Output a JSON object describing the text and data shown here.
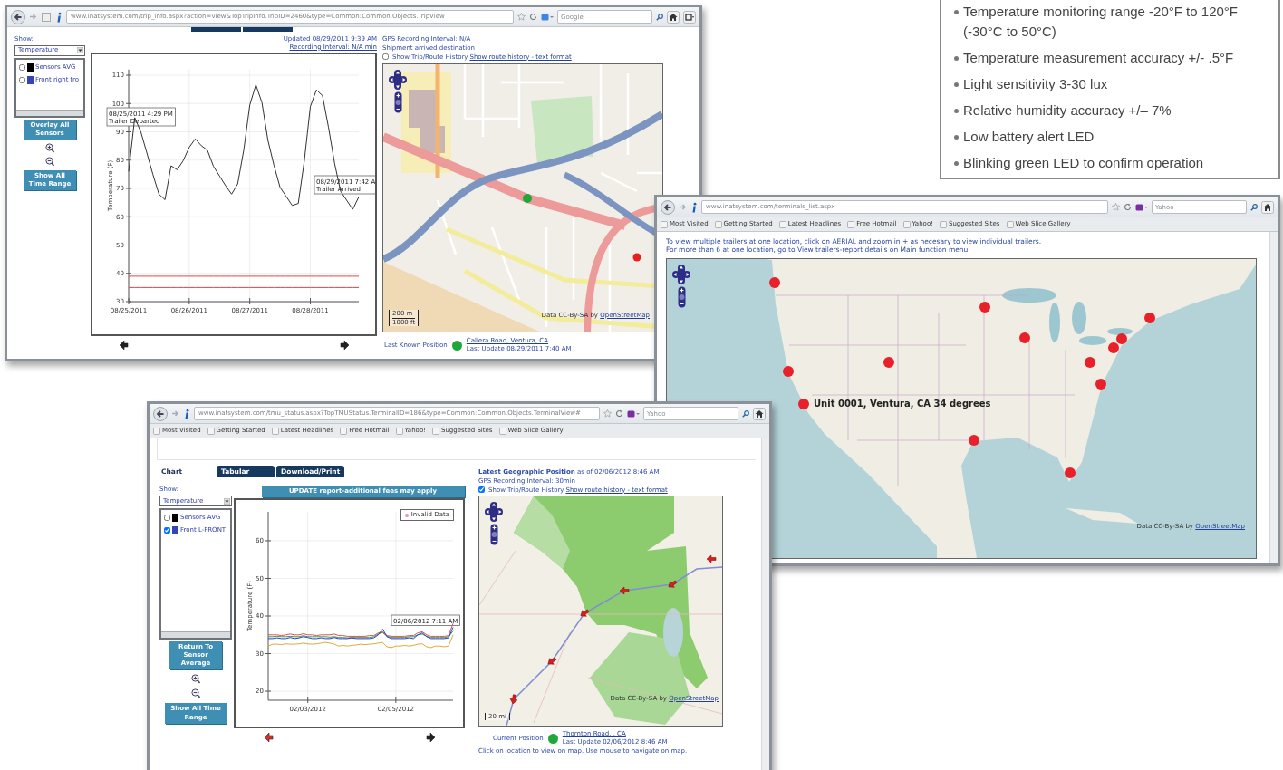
{
  "spec_box": {
    "items": [
      "Temperature monitoring range -20°F to 120°F (-30°C to 50°C)",
      "Temperature measurement accuracy +/- .5°F",
      "Light sensitivity 3-30 lux",
      "Relative humidity accuracy +/– 7%",
      "Low battery alert LED",
      "Blinking green LED to confirm operation"
    ]
  },
  "trip_window": {
    "url": "www.inatsystem.com/trip_info.aspx?action=view&TopTripInfo.TripID=2460&type=Common:Common.Objects.TripView",
    "search_placeholder": "Google",
    "show_label": "Show:",
    "sensor_select": "Temperature",
    "sensors": [
      {
        "name": "Sensors AVG",
        "color": "#000000",
        "checked": false
      },
      {
        "name": "Front right fro",
        "color": "#3344bb",
        "checked": false
      }
    ],
    "buttons": [
      "Overlay All Sensors",
      "Show All Time Range"
    ],
    "updated": "Updated 08/29/2011 9:39 AM",
    "recording_interval": "Recording Interval: N/A min",
    "chart_data": {
      "type": "line",
      "ylabel": "Temperature (F)",
      "ylim": [
        30,
        112
      ],
      "grid": true,
      "categories": [
        "08/25/2011",
        null,
        null,
        null,
        null,
        null,
        null,
        null,
        null,
        null,
        "08/26/2011",
        null,
        null,
        null,
        null,
        null,
        null,
        null,
        null,
        null,
        "08/27/2011",
        null,
        null,
        null,
        null,
        null,
        null,
        null,
        null,
        null,
        "08/28/2011",
        null,
        null,
        null,
        null,
        null,
        null,
        null,
        null
      ],
      "yticks": [
        30,
        40,
        50,
        60,
        70,
        80,
        90,
        100,
        110
      ],
      "series": [
        {
          "color": "#333333",
          "values": [
            76,
            95,
            90,
            82.5,
            75,
            68,
            66,
            78,
            76.6,
            79.8,
            84.5,
            87.5,
            85.1,
            83.5,
            77.8,
            74.4,
            71,
            68,
            71.6,
            83.5,
            99.5,
            106.6,
            100.3,
            87,
            78.1,
            70.4,
            67.2,
            64,
            64.7,
            79.6,
            98.9,
            104.8,
            102.8,
            91.5,
            78.8,
            69,
            65.8,
            62.6,
            67
          ]
        },
        {
          "color": "#e84040",
          "values": [
            39,
            39,
            39,
            39,
            39,
            39,
            39,
            39,
            39,
            39,
            39,
            39,
            39,
            39,
            39,
            39,
            39,
            39,
            39,
            39,
            39,
            39,
            39,
            39,
            39,
            39,
            39,
            39,
            39,
            39,
            39,
            39,
            39,
            39,
            39,
            39,
            39,
            39,
            39
          ]
        },
        {
          "color": "#e84040",
          "values": [
            35,
            35,
            35,
            35,
            35,
            35,
            35,
            35,
            35,
            35,
            35,
            35,
            35,
            35,
            35,
            35,
            35,
            35,
            35,
            35,
            35,
            35,
            35,
            35,
            35,
            35,
            35,
            35,
            35,
            35,
            35,
            35,
            35,
            35,
            35,
            35,
            35,
            35,
            35
          ]
        }
      ],
      "annotations": [
        "08/25/2011 4:29 PM\nTrailer Departed",
        "08/29/2011 7:42 A\nTrailer Arrived"
      ]
    },
    "gps_interval": "GPS Recording Interval: N/A",
    "shipment_status": "Shipment arrived destination",
    "route_history": {
      "checked": false,
      "label": "Show Trip/Route History",
      "link": "Show route history - text format"
    },
    "map": {
      "scale": [
        "200 m",
        "1000 ft"
      ],
      "attribution": "Data CC-By-SA by",
      "attribution_link": "OpenStreetMap"
    },
    "position_label": "Last Known Position",
    "location_link": "Callera Road, Ventura, CA",
    "last_update": "Last Update 08/29/2011 7:40 AM"
  },
  "terminals_window": {
    "url": "www.inatsystem.com/terminals_list.aspx",
    "search_placeholder": "Yahoo",
    "bookmarks": [
      "Most Visited",
      "Getting Started",
      "Latest Headlines",
      "Free Hotmail",
      "Yahoo!",
      "Suggested Sites",
      "Web Slice Gallery"
    ],
    "instructions": [
      "To view multiple trailers at one location, click on AERIAL and zoom in + as necesary to view individual trailers.",
      "For more than 6 at one location, go to View trailers-report details on Main function menu."
    ],
    "map_label": "Unit 0001, Ventura, CA 34 degrees",
    "map": {
      "attribution": "Data CC-By-SA by",
      "attribution_link": "OpenStreetMap"
    }
  },
  "status_window": {
    "url": "www.inatsystem.com/tmu_status.aspx?TopTMUStatus.TerminalID=186&type=Common:Common.Objects.TerminalView#",
    "search_placeholder": "Yahoo",
    "bookmarks": [
      "Most Visited",
      "Getting Started",
      "Latest Headlines",
      "Free Hotmail",
      "Yahoo!",
      "Suggested Sites",
      "Web Slice Gallery"
    ],
    "tabs": [
      {
        "label": "Chart",
        "selected": true
      },
      {
        "label": "Tabular",
        "selected": false
      },
      {
        "label": "Download/Print",
        "selected": false
      }
    ],
    "show_label": "Show:",
    "sensor_select": "Temperature",
    "sensors": [
      {
        "name": "Sensors AVG",
        "color": "#000000",
        "checked": false
      },
      {
        "name": "Front L-FRONT",
        "color": "#3344bb",
        "checked": true
      }
    ],
    "update_button": "UPDATE report-additional fees may apply",
    "data_key": {
      "label": "Invalid Data",
      "color": "#f48fb1"
    },
    "buttons": [
      "Return To Sensor Average",
      "Show All Time Range"
    ],
    "chart_data": {
      "type": "line",
      "ylabel": "Temperature (F)",
      "ylim": [
        17.6,
        67.7
      ],
      "grid": true,
      "categories": [
        null,
        null,
        null,
        null,
        null,
        null,
        null,
        null,
        null,
        "02/03/2012",
        null,
        null,
        null,
        null,
        null,
        null,
        null,
        null,
        null,
        null,
        null,
        null,
        null,
        null,
        null,
        null,
        null,
        null,
        null,
        "02/05/2012",
        null,
        null,
        null,
        null,
        null,
        null,
        null,
        null,
        null,
        null,
        null,
        null,
        null
      ],
      "yticks": [
        20,
        30,
        40,
        50,
        60
      ],
      "series": [
        {
          "color": "#e05050",
          "values": [
            35,
            35,
            35,
            34.8,
            35,
            35.2,
            35,
            35,
            35.3,
            35,
            35,
            34.8,
            35,
            35,
            35,
            35.2,
            34.8,
            34.8,
            34.6,
            34.6,
            34.6,
            34.6,
            34.6,
            34.8,
            34.8,
            35.5,
            35.8,
            34.8,
            34.6,
            34.6,
            34.6,
            34.6,
            34.8,
            34.8,
            35.5,
            35.8,
            35,
            34.6,
            34.6,
            34.6,
            34.6,
            34.8,
            38
          ]
        },
        {
          "color": "#3a9a4a",
          "values": [
            34.5,
            34.5,
            34.6,
            34.5,
            34.5,
            34.6,
            34.5,
            34.5,
            34.8,
            34.5,
            34.5,
            34.5,
            34.5,
            34.5,
            34.4,
            34.5,
            34.3,
            34.3,
            34.2,
            34.3,
            34.3,
            34.3,
            34.3,
            34.3,
            34.5,
            35.2,
            35.6,
            34.6,
            34.3,
            34.3,
            34.3,
            34.3,
            34.5,
            34.5,
            35,
            35.2,
            34.6,
            34.3,
            34.3,
            34.3,
            34.3,
            34.5,
            36
          ]
        },
        {
          "color": "#e0a93a",
          "values": [
            32,
            32.5,
            32.5,
            32.4,
            32.6,
            32.5,
            32.5,
            32.6,
            32.8,
            32.6,
            32.5,
            32.6,
            32.8,
            33,
            32.8,
            32.5,
            32,
            32.2,
            32,
            32.2,
            32.3,
            32.5,
            32.4,
            32.5,
            32.6,
            32.8,
            33,
            31.8,
            31.6,
            32,
            32,
            32.2,
            32,
            32.2,
            32.5,
            32.6,
            31.8,
            31.6,
            32,
            32,
            31.8,
            32,
            35
          ]
        },
        {
          "color": "#2b3fd0",
          "values": [
            34,
            34,
            34.2,
            34,
            34,
            34.3,
            34,
            34.2,
            34.5,
            34.3,
            34,
            34,
            34.2,
            34,
            34,
            34.3,
            34,
            34,
            34,
            34.2,
            34,
            34,
            34,
            34,
            34.2,
            35,
            36.5,
            34.5,
            34,
            34,
            34,
            34,
            34.2,
            34,
            35,
            35.5,
            34.5,
            34,
            34,
            34,
            34,
            34.2,
            37
          ]
        }
      ],
      "annotations": [
        "02/06/2012 7:11 AM"
      ]
    },
    "geo_title": "**Latest Geographic Position** as of 02/06/2012 8:46 AM",
    "gps_interval": "GPS Recording Interval: 30min",
    "route_history": {
      "checked": true,
      "label": "Show Trip/Route History",
      "link": "Show route history - text format"
    },
    "map": {
      "scale": [
        "20 mi"
      ],
      "attribution": "Data CC-By-SA by",
      "attribution_link": "OpenStreetMap"
    },
    "position_label": "Current Position",
    "location_link": "Thornton Road, , CA",
    "last_update": "Last Update 02/06/2012 8:46 AM",
    "hint": "Click on location to view on map. Use mouse to navigate on map."
  }
}
